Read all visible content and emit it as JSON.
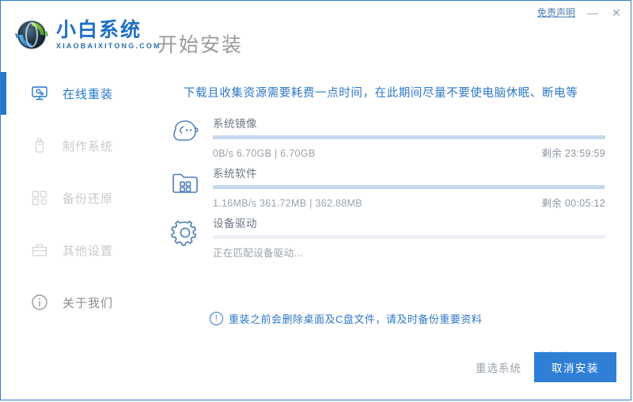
{
  "window": {
    "border_color": "#2f7fcf",
    "disclaimer_label": "免责声明",
    "minimize_label": "—",
    "close_label": "✕"
  },
  "brand": {
    "name_cn": "小白系统",
    "name_en": "XIAOBAIXITONG.COM",
    "logo_icon": "globe-refresh-icon"
  },
  "header": {
    "page_title": "开始安装"
  },
  "sidebar": {
    "items": [
      {
        "label": "在线重装",
        "icon": "monitor-icon",
        "active": true,
        "state": "active"
      },
      {
        "label": "制作系统",
        "icon": "usb-drive-icon",
        "active": false,
        "state": "disabled"
      },
      {
        "label": "备份还原",
        "icon": "restore-grid-icon",
        "active": false,
        "state": "disabled"
      },
      {
        "label": "其他设置",
        "icon": "toolbox-icon",
        "active": false,
        "state": "disabled"
      },
      {
        "label": "关于我们",
        "icon": "info-circle-icon",
        "active": false,
        "state": "normal"
      }
    ]
  },
  "main": {
    "notice": "下载且收集资源需要耗费一点时间，在此期间尽量不要使电脑休眠、断电等",
    "tasks": [
      {
        "name": "系统镜像",
        "icon": "ghost-face-icon",
        "progress_percent": 100,
        "detail": "0B/s 6.70GB | 6.70GB",
        "remaining": "剩余 23:59:59"
      },
      {
        "name": "系统软件",
        "icon": "folder-apps-icon",
        "progress_percent": 99.7,
        "detail": "1.16MB/s 361.72MB | 362.88MB",
        "remaining": "剩余 00:05:12"
      },
      {
        "name": "设备驱动",
        "icon": "gear-icon",
        "progress_percent": 0,
        "detail": "正在匹配设备驱动...",
        "remaining": ""
      }
    ],
    "warning": {
      "icon": "exclamation-circle-icon",
      "glyph": "!",
      "text": "重装之前会删除桌面及C盘文件，请及时备份重要资料"
    }
  },
  "footer": {
    "reselect_label": "重选系统",
    "cancel_label": "取消安装",
    "primary_color": "#2f7fd6"
  },
  "watermark": {
    "text": "装机吧"
  }
}
